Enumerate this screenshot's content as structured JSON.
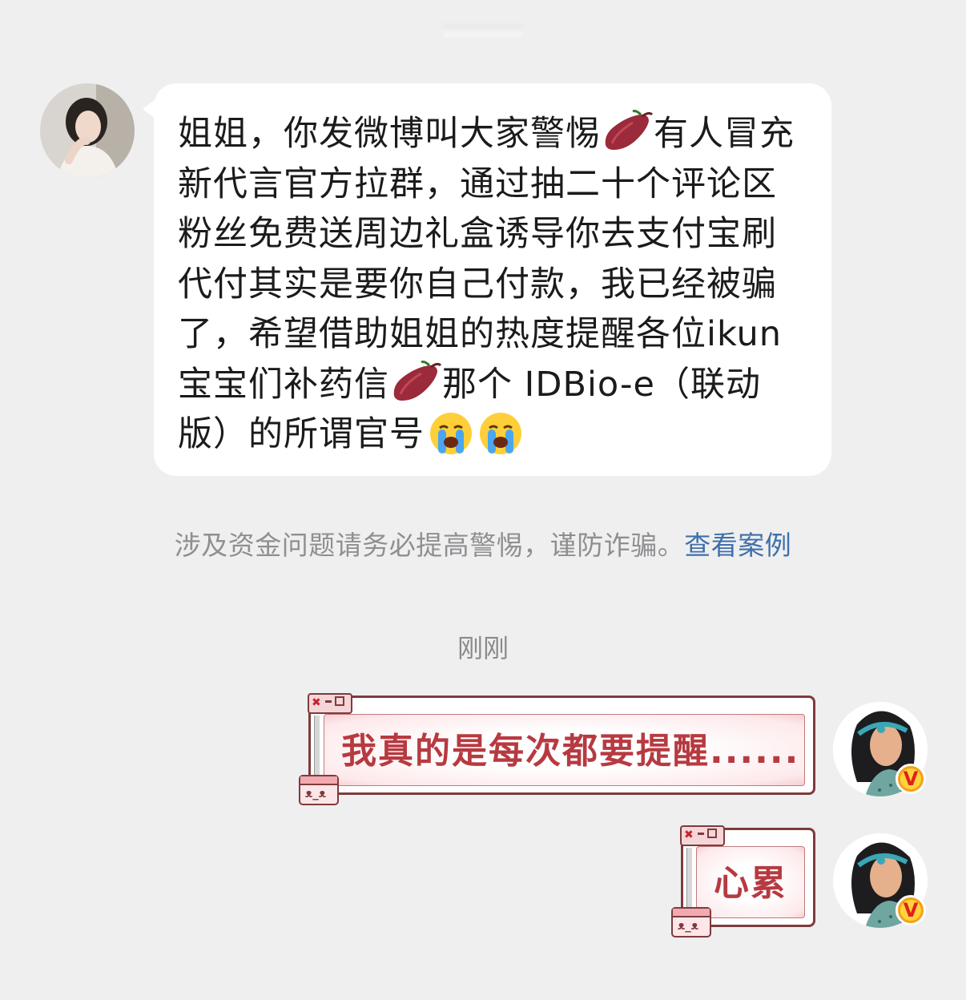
{
  "incoming": {
    "avatar": "woman-portrait-avatar",
    "text_before_potato1": "姐姐，你发微博叫大家警惕",
    "potato_emoji": "sweet-potato-emoji",
    "text_after_potato1": "有人冒充新代言官方拉群，通过抽二十个评论区粉丝免费送周边礼盒诱导你去支付宝刷代付其实是要你自己付款，我已经被骗了，希望借助姐姐的热度提醒各位ikun宝宝们补药信",
    "text_after_potato2": "那个 IDBio-e（联动版）的所谓官号",
    "cry_emoji": "loudly-crying-face-emoji"
  },
  "warning": {
    "text": "涉及资金问题请务必提高警惕，谨防诈骗。",
    "link": "查看案例"
  },
  "timestamp": "刚刚",
  "outgoing": [
    {
      "text": "我真的是每次都要提醒......",
      "avatar": "princess-avatar",
      "badge": "V"
    },
    {
      "text": "心累",
      "avatar": "princess-avatar",
      "badge": "V"
    }
  ],
  "colors": {
    "background": "#efeff0",
    "bubble_text": "#b73a41",
    "link": "#3f6fab",
    "bubble_border": "#7e3b3c"
  }
}
